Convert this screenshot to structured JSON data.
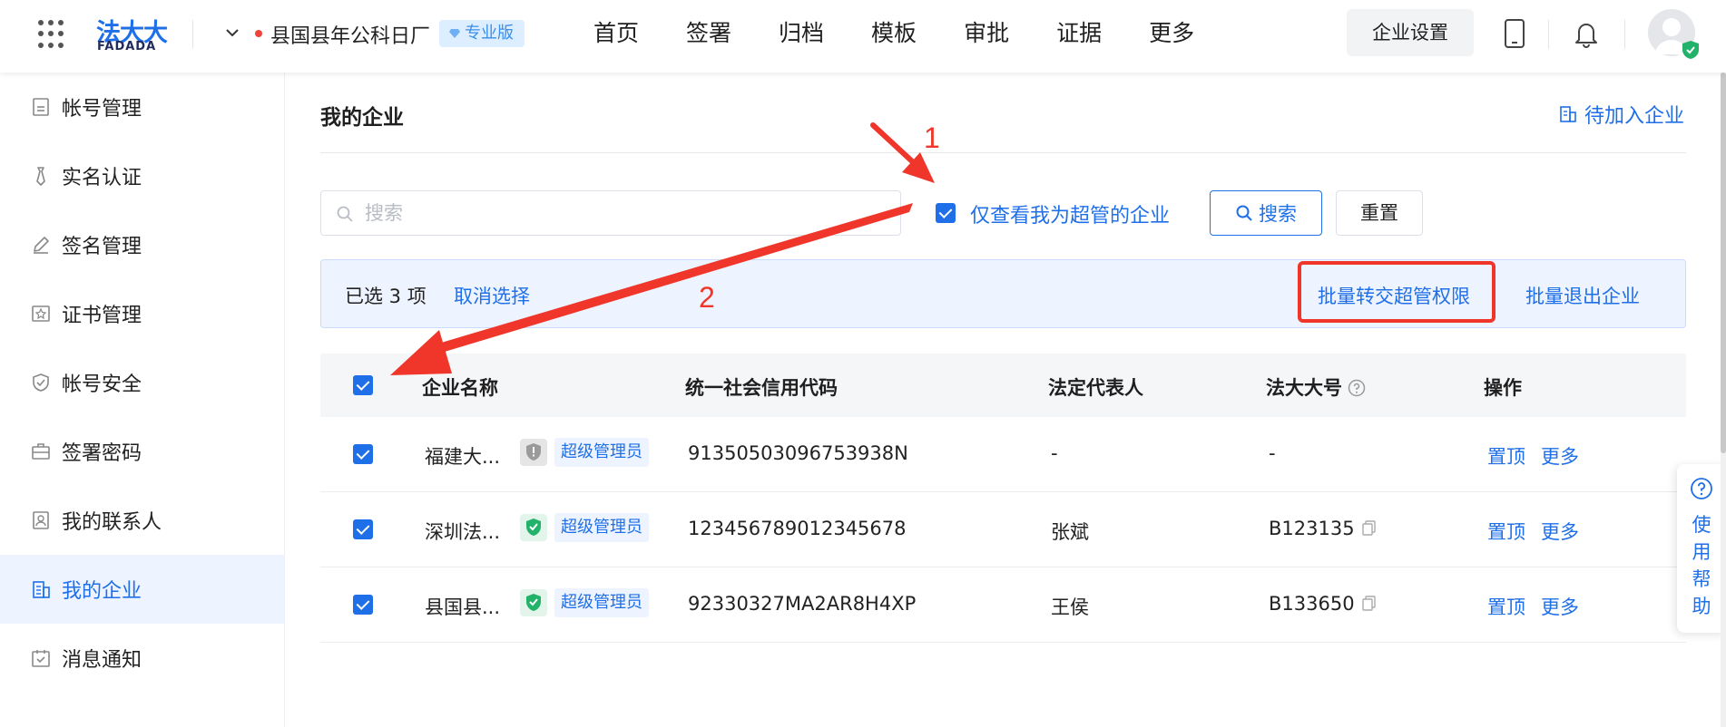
{
  "header": {
    "logo_cn": "法大大",
    "logo_en": "FADADA",
    "org_name": "县国县年公科日厂",
    "edition_badge": "专业版",
    "nav": [
      "首页",
      "签署",
      "归档",
      "模板",
      "审批",
      "证据",
      "更多"
    ],
    "enterprise_settings": "企业设置"
  },
  "sidebar": {
    "items": [
      {
        "label": "帐号管理",
        "icon": "account-icon"
      },
      {
        "label": "实名认证",
        "icon": "tie-icon"
      },
      {
        "label": "签名管理",
        "icon": "pen-icon"
      },
      {
        "label": "证书管理",
        "icon": "certificate-icon"
      },
      {
        "label": "帐号安全",
        "icon": "shield-icon"
      },
      {
        "label": "签署密码",
        "icon": "briefcase-icon"
      },
      {
        "label": "我的联系人",
        "icon": "contact-icon"
      },
      {
        "label": "我的企业",
        "icon": "building-icon"
      },
      {
        "label": "消息通知",
        "icon": "notice-icon"
      }
    ],
    "active_index": 7
  },
  "main": {
    "title": "我的企业",
    "pending_link": "待加入企业",
    "search_placeholder": "搜索",
    "filter_label": "仅查看我为超管的企业",
    "search_button": "搜索",
    "reset_button": "重置"
  },
  "selection_bar": {
    "count_text": "已选 3 项",
    "cancel": "取消选择",
    "batch_transfer": "批量转交超管权限",
    "batch_exit": "批量退出企业"
  },
  "table": {
    "headers": [
      "企业名称",
      "统一社会信用代码",
      "法定代表人",
      "法大大号",
      "操作"
    ],
    "rows": [
      {
        "name": "福建大...",
        "shield": "gray",
        "role": "超级管理员",
        "code": "91350503096753938N",
        "legal": "-",
        "fdd": "-",
        "ops": [
          "置顶",
          "更多"
        ]
      },
      {
        "name": "深圳法...",
        "shield": "green",
        "role": "超级管理员",
        "code": "123456789012345678",
        "legal": "张斌",
        "fdd": "B123135",
        "ops": [
          "置顶",
          "更多"
        ]
      },
      {
        "name": "县国县...",
        "shield": "green",
        "role": "超级管理员",
        "code": "92330327MA2AR8H4XP",
        "legal": "王侯",
        "fdd": "B133650",
        "ops": [
          "置顶",
          "更多"
        ]
      }
    ]
  },
  "help_float": "使用帮助",
  "annotations": {
    "step1": "1",
    "step2": "2"
  },
  "colors": {
    "accent": "#1e6fe8",
    "annotation": "#f0362a",
    "shield_green": "#22b26a",
    "shield_gray": "#9a9a9a"
  }
}
